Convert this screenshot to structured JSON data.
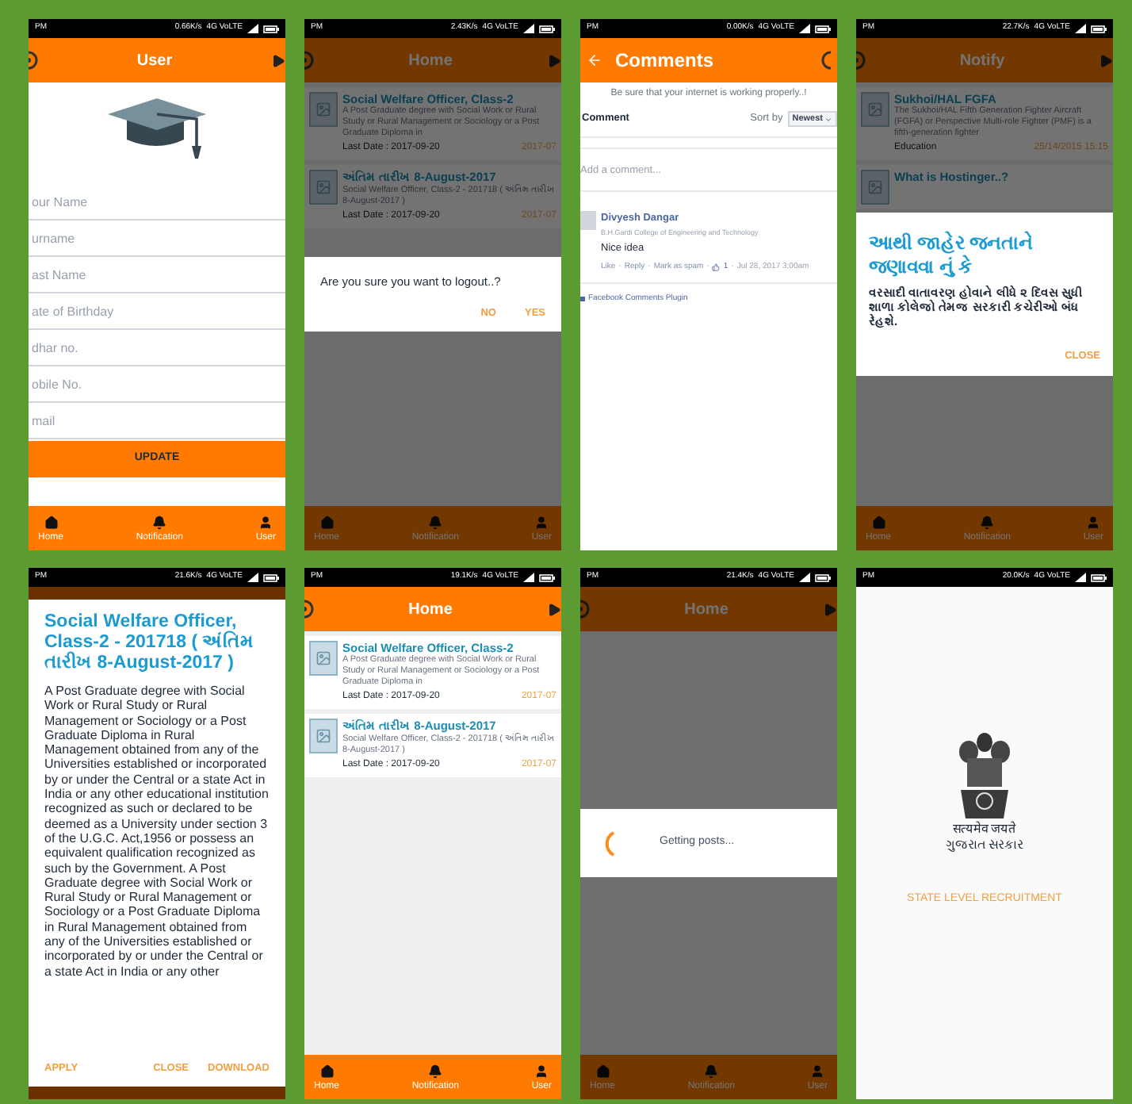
{
  "screens": [
    {
      "kind": "user_form",
      "status_bar": {
        "time": "PM",
        "speed": "0.66K/s",
        "network": "4G VoLTE"
      },
      "app_bar": {
        "title": "User"
      },
      "fields": [
        {
          "placeholder": "our Name"
        },
        {
          "placeholder": "urname"
        },
        {
          "placeholder": "ast Name"
        },
        {
          "placeholder": "ate of Birthday"
        },
        {
          "placeholder": "dhar no."
        },
        {
          "placeholder": "obile No."
        },
        {
          "placeholder": "mail"
        }
      ],
      "button": "UPDATE",
      "bottom_nav": [
        {
          "label": "Home"
        },
        {
          "label": "Notification"
        },
        {
          "label": "User"
        }
      ]
    },
    {
      "kind": "post_list",
      "status_bar": {
        "time": "PM",
        "speed": "2.43K/s",
        "network": "4G VoLTE"
      },
      "app_bar": {
        "title": "Home"
      },
      "dimmed": true,
      "posts": [
        {
          "title": "Social Welfare Officer, Class-2",
          "summary": "A Post Graduate degree with Social Work or Rural Study or Rural Management or Sociology or a Post Graduate Diploma in",
          "footer": "Last Date : 2017-09-20",
          "date": "2017-07"
        },
        {
          "title": "અંતિમ તારીખ 8-August-2017",
          "summary": "Social Welfare Officer, Class-2 - 201718 ( અંતિમ તારીખ 8-August-2017 )",
          "footer": "Last Date : 2017-09-20",
          "date": "2017-07"
        }
      ],
      "dialog": {
        "kind": "confirm",
        "message": "Are you sure you want to logout..?",
        "actions": [
          "NO",
          "YES"
        ]
      },
      "bottom_nav": [
        {
          "label": "Home"
        },
        {
          "label": "Notification"
        },
        {
          "label": "User"
        }
      ]
    },
    {
      "kind": "comments",
      "status_bar": {
        "time": "PM",
        "speed": "0.00K/s",
        "network": "4G VoLTE"
      },
      "app_bar": {
        "title": "Comments"
      },
      "notice": "Be sure that your internet is working properly..!",
      "header": {
        "label": "Comment",
        "sort_label": "Sort by",
        "sort_value": "Newest"
      },
      "input": {
        "placeholder": "Add a comment..."
      },
      "comments": [
        {
          "author": "Divyesh Dangar",
          "affiliation": "B.H.Gardi College of Engineering and Technology",
          "text": "Nice idea",
          "actions": [
            "Like",
            "Reply",
            "Mark as spam"
          ],
          "separator": "·",
          "likes": "1",
          "time": "Jul 28, 2017 3:00am"
        }
      ],
      "plugin_label": "Facebook Comments Plugin"
    },
    {
      "kind": "post_list",
      "status_bar": {
        "time": "PM",
        "speed": "22.7K/s",
        "network": "4G VoLTE"
      },
      "app_bar": {
        "title": "Notify"
      },
      "dimmed": true,
      "posts": [
        {
          "title": "Sukhoi/HAL FGFA",
          "summary": "The Sukhoi/HAL Fifth Generation Fighter Aircraft (FGFA) or Perspective Multi-role Fighter (PMF) is a fifth-generation fighter",
          "footer": "Education",
          "date": "25/14/2015 15:15"
        },
        {
          "title": "What is Hostinger..?"
        }
      ],
      "dialog": {
        "kind": "alert",
        "title": "આથી જાહેર જનતાને જણાવવા નું કે",
        "message": "વરસાદી વાતાવરણ હોવાને લીધે ૨ દિવસ સુધી શાળા કોલેજો તેમજ સરકારી કચેરીઓ બંધ રેહશે.",
        "actions": [
          "CLOSE"
        ]
      },
      "bottom_nav": [
        {
          "label": "Home"
        },
        {
          "label": "Notification"
        },
        {
          "label": "User"
        }
      ]
    },
    {
      "kind": "post_detail",
      "status_bar": {
        "time": "PM",
        "speed": "21.6K/s",
        "network": "4G VoLTE"
      },
      "title": "Social Welfare Officer, Class-2 - 201718 ( અંતિમ તારીખ 8-August-2017 )",
      "body": "A Post Graduate degree with Social Work or Rural Study or Rural Management or Sociology or a Post Graduate Diploma in Rural Management obtained from any of the Universities established or incorporated by or under the Central or a state Act in India or any other educational institution recognized as such or declared to be deemed as a University under section 3 of the U.G.C. Act,1956 or possess an equivalent qualification recognized as such by the Government. A Post Graduate degree with Social Work or Rural Study or Rural Management or Sociology or a Post Graduate Diploma in Rural Management obtained from any of the Universities established or incorporated by or under the Central or a state Act in India or any other",
      "actions": [
        "APPLY",
        "CLOSE",
        "DOWNLOAD"
      ]
    },
    {
      "kind": "post_list",
      "status_bar": {
        "time": "PM",
        "speed": "19.1K/s",
        "network": "4G VoLTE"
      },
      "app_bar": {
        "title": "Home"
      },
      "posts": [
        {
          "title": "Social Welfare Officer, Class-2",
          "summary": "A Post Graduate degree with Social Work or Rural Study or Rural Management or Sociology or a Post Graduate Diploma in",
          "footer": "Last Date : 2017-09-20",
          "date": "2017-07"
        },
        {
          "title": "અંતિમ તારીખ 8-August-2017",
          "summary": "Social Welfare Officer, Class-2 - 201718 ( અંતિમ તારીખ 8-August-2017 )",
          "footer": "Last Date : 2017-09-20",
          "date": "2017-07"
        }
      ],
      "bottom_nav": [
        {
          "label": "Home"
        },
        {
          "label": "Notification"
        },
        {
          "label": "User"
        }
      ]
    },
    {
      "kind": "loading",
      "status_bar": {
        "time": "PM",
        "speed": "21.4K/s",
        "network": "4G VoLTE"
      },
      "app_bar": {
        "title": "Home"
      },
      "dimmed": true,
      "dialog": {
        "kind": "progress",
        "message": "Getting posts..."
      },
      "bottom_nav": [
        {
          "label": "Home"
        },
        {
          "label": "Notification"
        },
        {
          "label": "User"
        }
      ]
    },
    {
      "kind": "splash",
      "status_bar": {
        "time": "PM",
        "speed": "20.0K/s",
        "network": "4G VoLTE"
      },
      "emblem_caption": [
        "सत्यमेव जयते",
        "ગુજરાત સરકાર"
      ],
      "tagline": "STATE LEVEL RECRUITMENT"
    }
  ]
}
